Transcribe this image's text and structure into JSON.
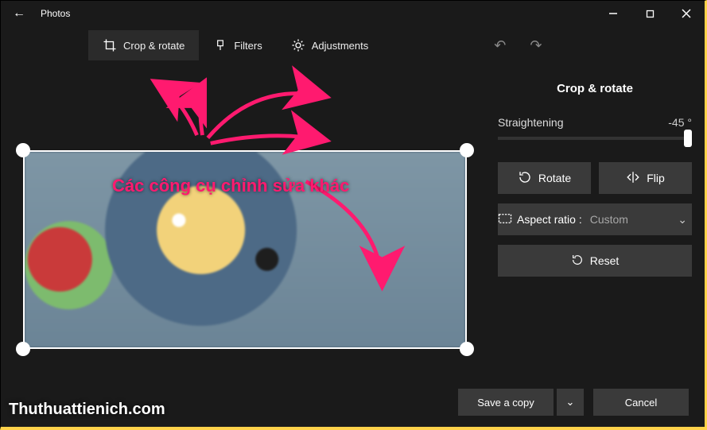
{
  "titlebar": {
    "app_name": "Photos"
  },
  "toolbar": {
    "crop_label": "Crop & rotate",
    "filters_label": "Filters",
    "adjustments_label": "Adjustments"
  },
  "panel": {
    "title": "Crop & rotate",
    "straightening_label": "Straightening",
    "straightening_value": "-45 °",
    "rotate_label": "Rotate",
    "flip_label": "Flip",
    "aspect_label": "Aspect ratio :",
    "aspect_value": "Custom",
    "reset_label": "Reset"
  },
  "footer": {
    "save_label": "Save a copy",
    "cancel_label": "Cancel"
  },
  "annotation": {
    "text": "Các công cụ chỉnh sửa khác"
  },
  "watermark": {
    "text": "Thuthuattienich.com"
  }
}
